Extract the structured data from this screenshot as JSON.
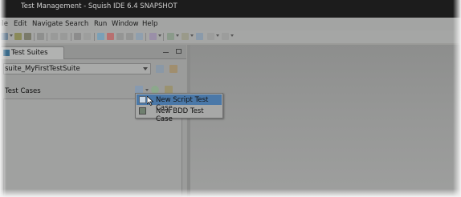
{
  "window": {
    "title": "Test Management - Squish IDE 6.4 SNAPSHOT"
  },
  "menubar": {
    "items": [
      "ile",
      "Edit",
      "Navigate",
      "Search",
      "Run",
      "Window",
      "Help"
    ]
  },
  "test_suites_view": {
    "tab_label": "Test Suites",
    "suite_selector_value": "suite_MyFirstTestSuite",
    "test_cases_label": "Test Cases"
  },
  "new_test_case_menu": {
    "items": [
      {
        "label": "New Script Test Case",
        "icon": "script-test-case-icon",
        "highlighted": true
      },
      {
        "label": "New BDD Test Case",
        "icon": "bdd-test-case-icon",
        "highlighted": false
      }
    ]
  },
  "colors": {
    "selection": "#4a78a8",
    "titlebar": "#1c1c1c"
  }
}
